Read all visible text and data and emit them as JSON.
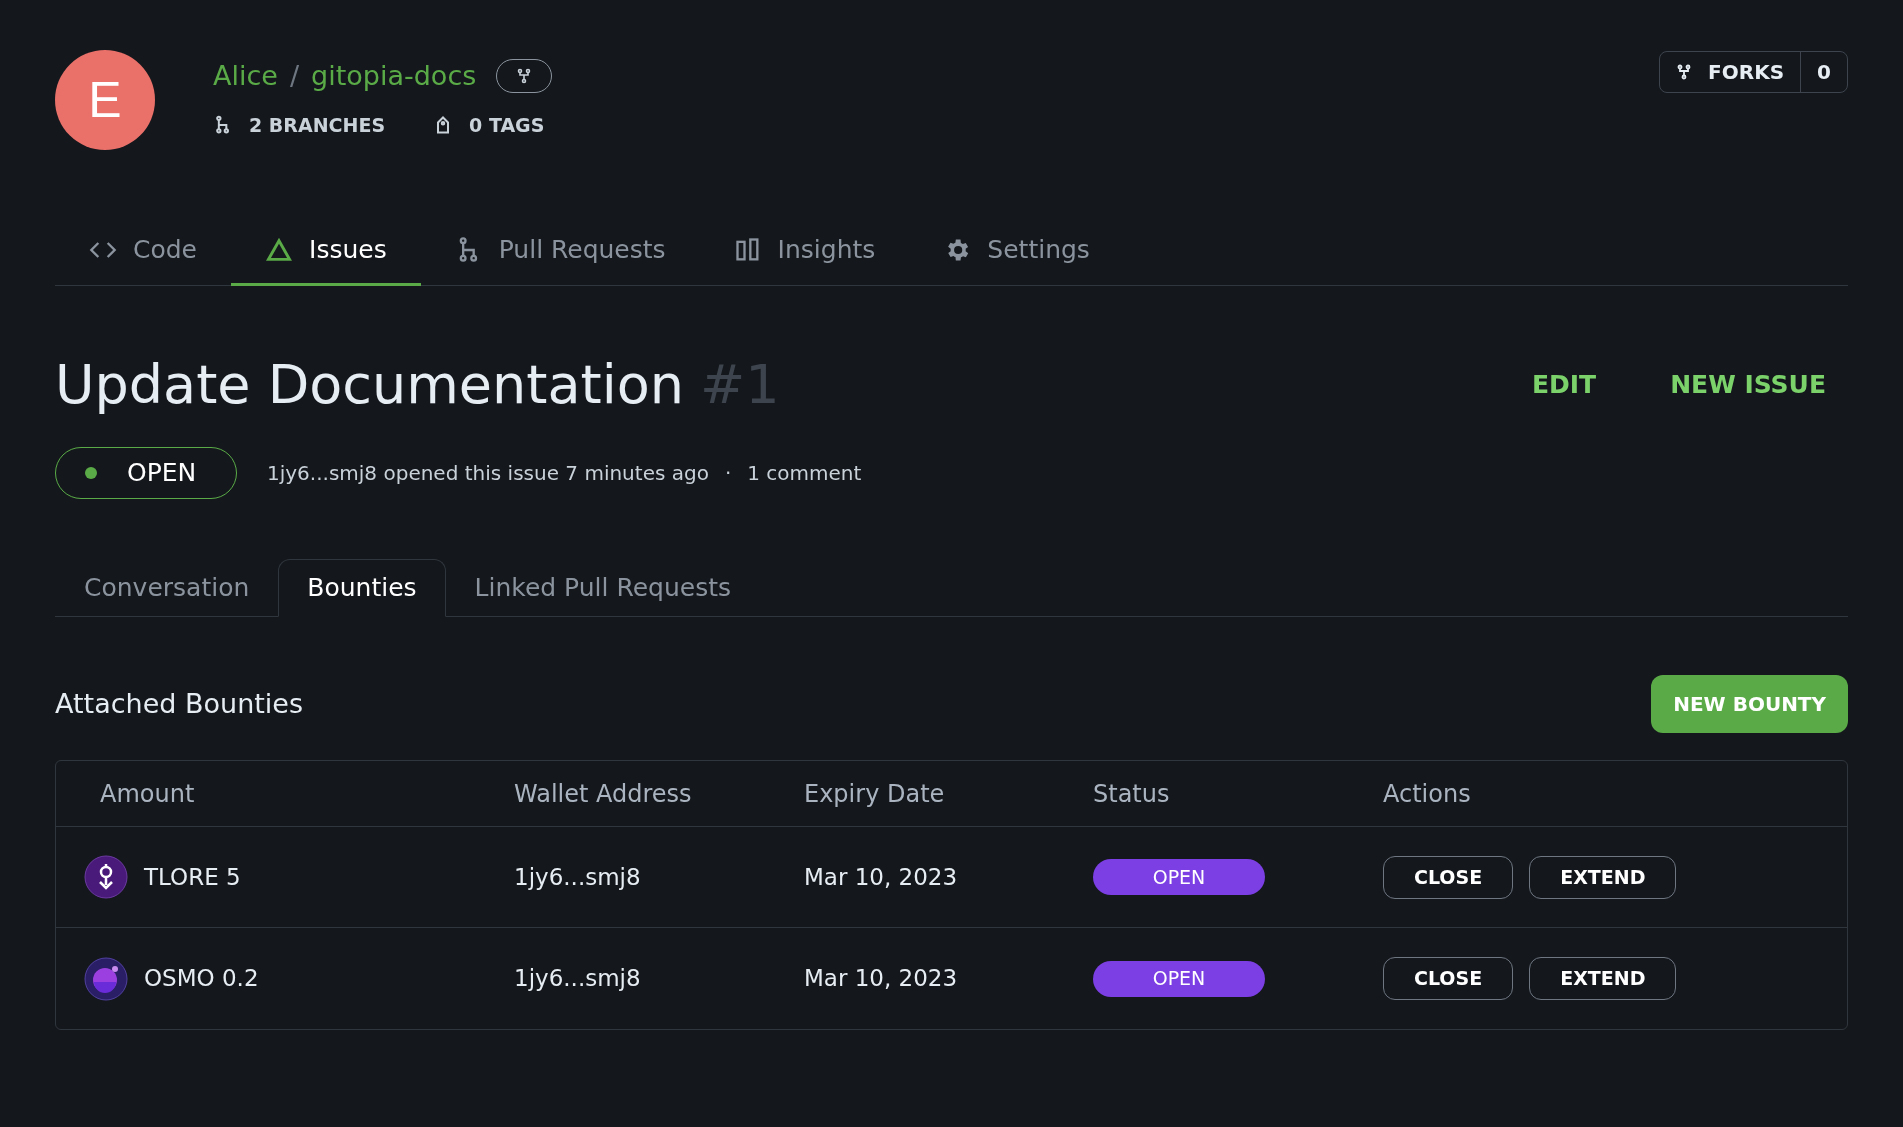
{
  "repo": {
    "avatar_letter": "E",
    "owner": "Alice",
    "separator": "/",
    "name": "gitopia-docs",
    "branches": "2 BRANCHES",
    "tags": "0 TAGS",
    "forks_label": "FORKS",
    "forks_count": "0"
  },
  "nav_tabs": [
    {
      "label": "Code",
      "kind": "code",
      "selected": false
    },
    {
      "label": "Issues",
      "kind": "issues",
      "selected": true
    },
    {
      "label": "Pull Requests",
      "kind": "pulls",
      "selected": false
    },
    {
      "label": "Insights",
      "kind": "insights",
      "selected": false
    },
    {
      "label": "Settings",
      "kind": "settings",
      "selected": false
    }
  ],
  "issue": {
    "title": "Update Documentation",
    "number": "#1",
    "state": "OPEN",
    "meta": "1jy6...smj8 opened this issue 7 minutes ago",
    "separator": "·",
    "comments": "1 comment",
    "actions": [
      "EDIT",
      "NEW ISSUE"
    ]
  },
  "issue_tabs": [
    {
      "label": "Conversation",
      "selected": false
    },
    {
      "label": "Bounties",
      "selected": true
    },
    {
      "label": "Linked Pull Requests",
      "selected": false
    }
  ],
  "bounties": {
    "heading": "Attached Bounties",
    "new_button": "NEW BOUNTY",
    "columns": [
      "Amount",
      "Wallet Address",
      "Expiry Date",
      "Status",
      "Actions"
    ],
    "rows": [
      {
        "kind": "tlore",
        "amount": "TLORE 5",
        "wallet": "1jy6...smj8",
        "expiry": "Mar 10, 2023",
        "status": "OPEN",
        "actions": [
          "CLOSE",
          "EXTEND"
        ]
      },
      {
        "kind": "osmo",
        "amount": "OSMO 0.2",
        "wallet": "1jy6...smj8",
        "expiry": "Mar 10, 2023",
        "status": "OPEN",
        "actions": [
          "CLOSE",
          "EXTEND"
        ]
      }
    ]
  }
}
